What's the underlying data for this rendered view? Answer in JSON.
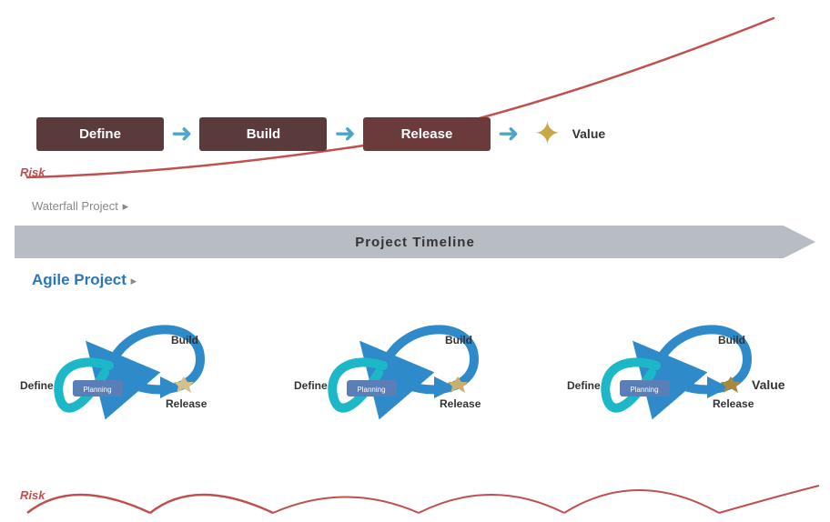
{
  "waterfall": {
    "blocks": [
      "Define",
      "Build",
      "Release"
    ],
    "value_label": "Value",
    "risk_label": "Risk",
    "section_title": "Waterfall Project",
    "section_title_suffix": "▸"
  },
  "timeline": {
    "label": "Project Timeline"
  },
  "agile": {
    "section_title": "Agile Project",
    "section_title_suffix": "▸",
    "cycles": [
      {
        "define": "Define",
        "build": "Build",
        "release": "Release",
        "has_value": false
      },
      {
        "define": "Define",
        "build": "Build",
        "release": "Release",
        "has_value": false
      },
      {
        "define": "Define",
        "build": "Build",
        "release": "Release",
        "has_value": true,
        "value_label": "Value"
      }
    ],
    "risk_label": "Risk"
  },
  "colors": {
    "block_bg": "#5a3838",
    "arrow_blue": "#4da6c8",
    "star_gold": "#c8a84b",
    "risk_red": "#c0504d",
    "timeline_gray": "#b8bdc4",
    "agile_blue": "#2e75b6",
    "text_dark": "#333333"
  }
}
